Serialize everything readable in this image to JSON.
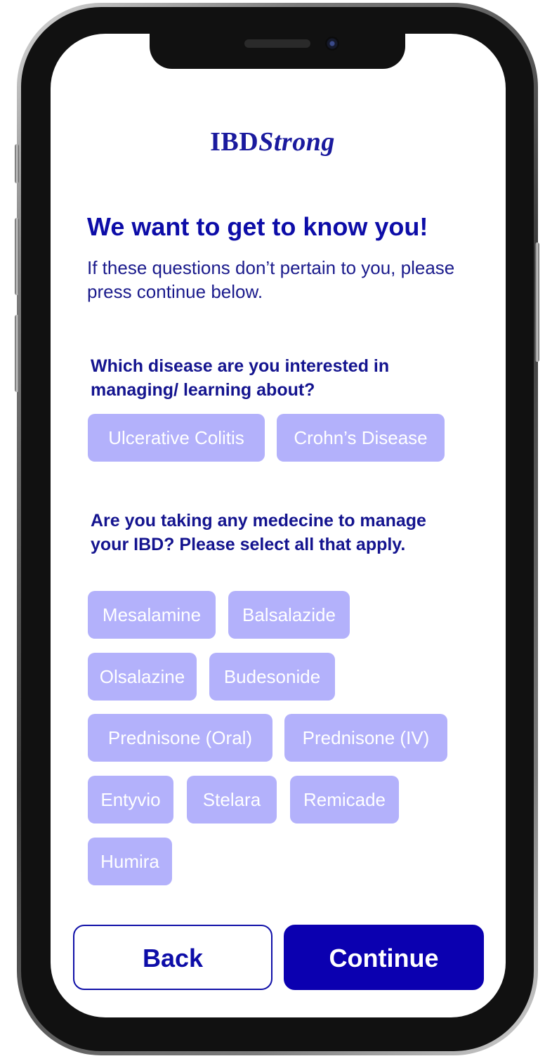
{
  "app": {
    "logo_bold": "IBD",
    "logo_italic": "Strong"
  },
  "header": {
    "title": "We want to get to know you!",
    "subtitle": "If these questions don’t pertain to you, please press continue below."
  },
  "disease_question": {
    "text": "Which disease are you interested in managing/ learning about?",
    "options": [
      "Ulcerative Colitis",
      "Crohn’s Disease"
    ]
  },
  "medicine_question": {
    "text": "Are you taking any medecine to manage your IBD? Please select all that apply.",
    "options": [
      "Mesalamine",
      "Balsalazide",
      "Olsalazine",
      "Budesonide",
      "Prednisone (Oral)",
      "Prednisone (IV)",
      "Entyvio",
      "Stelara",
      "Remicade",
      "Humira"
    ]
  },
  "footer": {
    "back_label": "Back",
    "continue_label": "Continue"
  },
  "colors": {
    "brand_blue": "#0b00b0",
    "chip_fill": "#b3b1fb",
    "text_blue": "#1b1b8c"
  }
}
